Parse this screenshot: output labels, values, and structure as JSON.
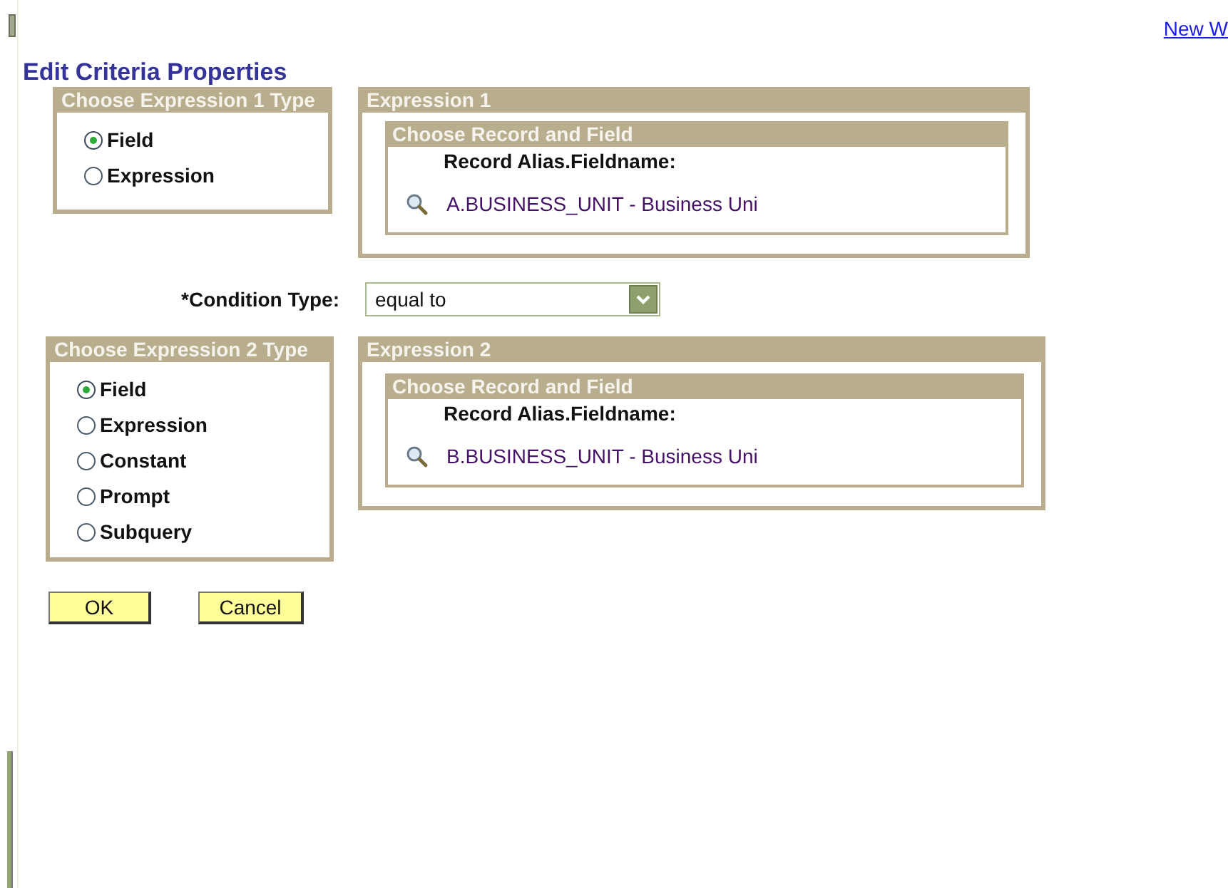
{
  "link": "New W",
  "title": "Edit Criteria Properties",
  "sections": [
    {
      "type_box": {
        "header": "Choose Expression 1 Type",
        "options": [
          {
            "label": "Field",
            "selected": true
          },
          {
            "label": "Expression",
            "selected": false
          }
        ]
      },
      "expression": {
        "header": "Expression 1",
        "inner_header": "Choose Record and Field",
        "field_label": "Record Alias.Fieldname:",
        "value": "A.BUSINESS_UNIT - Business Uni"
      }
    },
    {
      "type_box": {
        "header": "Choose Expression 2 Type",
        "options": [
          {
            "label": "Field",
            "selected": true
          },
          {
            "label": "Expression",
            "selected": false
          },
          {
            "label": "Constant",
            "selected": false
          },
          {
            "label": "Prompt",
            "selected": false
          },
          {
            "label": "Subquery",
            "selected": false
          }
        ]
      },
      "expression": {
        "header": "Expression 2",
        "inner_header": "Choose Record and Field",
        "field_label": "Record Alias.Fieldname:",
        "value": "B.BUSINESS_UNIT - Business Uni"
      }
    }
  ],
  "condition": {
    "label": "*Condition Type:",
    "value": "equal to"
  },
  "buttons": [
    "OK",
    "Cancel"
  ]
}
